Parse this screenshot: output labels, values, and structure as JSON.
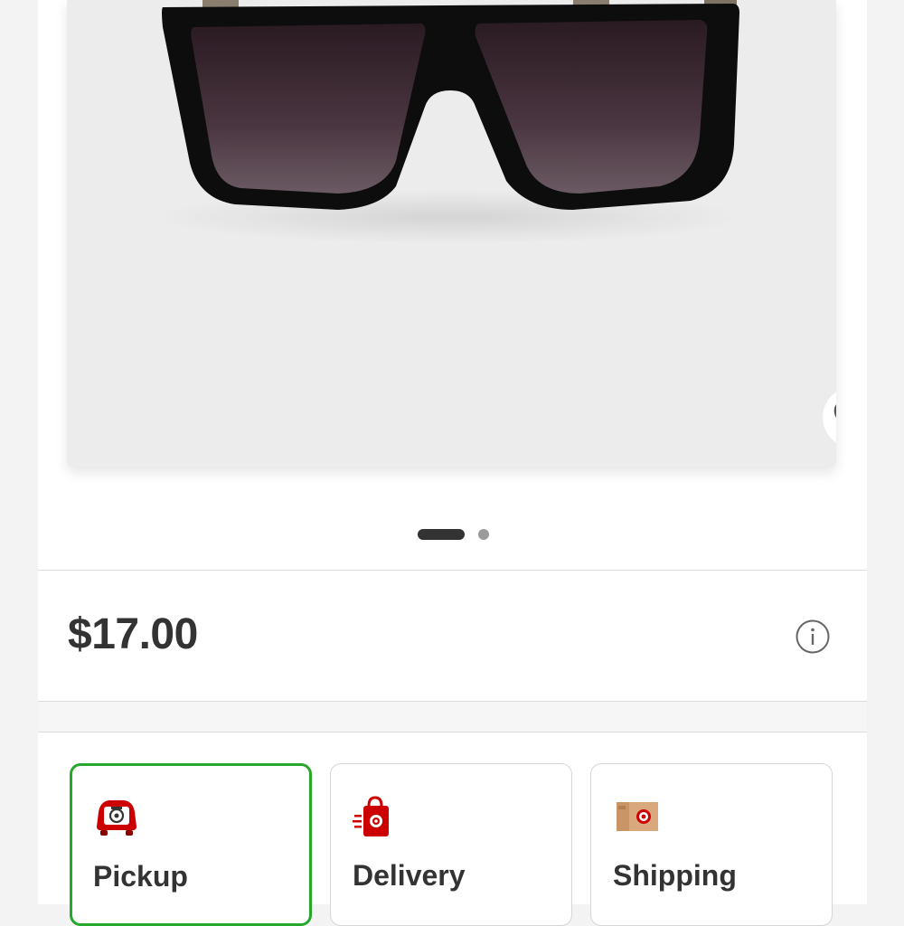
{
  "product": {
    "image_alt": "Black flat-top oversized sunglasses with gradient lenses",
    "favorite_icon": "heart-outline-icon",
    "carousel": {
      "total": 2,
      "active": 1
    }
  },
  "pricing": {
    "price": "$17.00",
    "info_icon": "info-circle-icon"
  },
  "fulfillment": {
    "options": [
      {
        "label": "Pickup",
        "icon": "pickup-car-icon",
        "selected": true
      },
      {
        "label": "Delivery",
        "icon": "delivery-bag-icon",
        "selected": false
      },
      {
        "label": "Shipping",
        "icon": "shipping-box-icon",
        "selected": false
      }
    ]
  },
  "colors": {
    "brand_red": "#cc0000",
    "selected_border": "#25a82b",
    "text": "#333333"
  }
}
